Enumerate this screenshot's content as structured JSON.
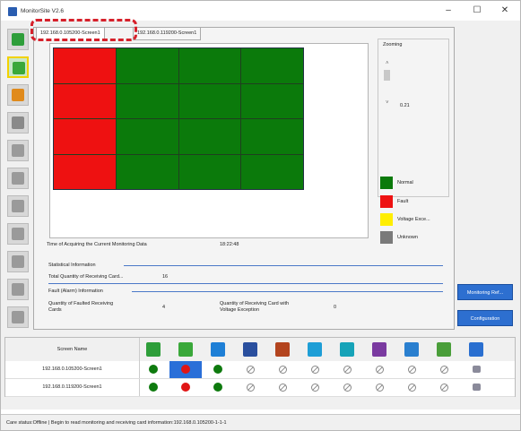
{
  "window": {
    "title": "MonitorSite V2.6",
    "minimize": "–",
    "maximize": "☐",
    "close": "✕"
  },
  "tabs": [
    {
      "label": "192.168.0.105200-Screen1",
      "selected": true
    },
    {
      "label": "192.168.0.119200-Screen1",
      "selected": false
    }
  ],
  "cabinet_grid": {
    "rows": 4,
    "cols": 4,
    "cells": [
      [
        "fault",
        "normal",
        "normal",
        "normal"
      ],
      [
        "fault",
        "normal",
        "normal",
        "normal"
      ],
      [
        "fault",
        "normal",
        "normal",
        "normal"
      ],
      [
        "fault",
        "normal",
        "normal",
        "normal"
      ]
    ]
  },
  "zoom": {
    "label": "Zooming",
    "value": "0.21"
  },
  "legend": [
    {
      "label": "Normal",
      "color": "#0b7a0b"
    },
    {
      "label": "Fault",
      "color": "#ee1111"
    },
    {
      "label": "Voltage Exce...",
      "color": "#ffee00"
    },
    {
      "label": "Unknown",
      "color": "#7a7a7a"
    }
  ],
  "info": {
    "time_label": "Time of Acquiring the Current Monitoring Data",
    "time_value": "18:22:48",
    "stat_header": "Statistical Information",
    "total_label": "Total Quantity of Receiving Card...",
    "total_value": "16",
    "fault_header": "Fault (Alarm) Information",
    "faulted_label_1": "Quantity of Faulted Receiving",
    "faulted_label_2": "Cards",
    "faulted_value": "4",
    "voltage_label_1": "Quantity of Receiving Card with",
    "voltage_label_2": "Voltage Exception",
    "voltage_value": "0"
  },
  "side_buttons": {
    "monitoring": "Monitoring Ref...",
    "configuration": "Configuration"
  },
  "left_toolbar": [
    {
      "icon": "monitor-green-icon",
      "color": "#2e9e3a"
    },
    {
      "icon": "receiving-card-icon",
      "color": "#3aa83a"
    },
    {
      "icon": "temperature-icon",
      "color": "#e08a1c"
    },
    {
      "icon": "disk-icon",
      "color": "#8a8a8a"
    },
    {
      "icon": "smoke-icon",
      "color": "#9a9a9a"
    },
    {
      "icon": "flame-icon",
      "color": "#9a9a9a"
    },
    {
      "icon": "fan-icon",
      "color": "#9a9a9a"
    },
    {
      "icon": "voltage-icon",
      "color": "#9a9a9a"
    },
    {
      "icon": "magnet-icon",
      "color": "#9a9a9a"
    },
    {
      "icon": "door-icon",
      "color": "#9a9a9a"
    },
    {
      "icon": "module-icon",
      "color": "#9a9a9a"
    }
  ],
  "table": {
    "header": "Screen Name",
    "header_icons": [
      {
        "name": "monitor-green-icon",
        "color": "#2e9e3a"
      },
      {
        "name": "receiving-card-icon",
        "color": "#3aa83a"
      },
      {
        "name": "temperature-icon",
        "color": "#1e7fd6"
      },
      {
        "name": "disk-icon",
        "color": "#2a4f9e"
      },
      {
        "name": "smoke-icon",
        "color": "#b3441e"
      },
      {
        "name": "fan-icon",
        "color": "#1e9ed6"
      },
      {
        "name": "voltage-icon",
        "color": "#16a3b8"
      },
      {
        "name": "magnet-icon",
        "color": "#7a3aa0"
      },
      {
        "name": "door-icon",
        "color": "#2a7fcf"
      },
      {
        "name": "module-icon",
        "color": "#4a9e3a"
      },
      {
        "name": "globe-icon",
        "color": "#2a6fd0"
      }
    ],
    "rows": [
      {
        "name": "192.168.0.105200-Screen1",
        "cells": [
          "green",
          "red-selected",
          "green",
          "na",
          "na",
          "na",
          "na",
          "na",
          "na",
          "na",
          "monitor"
        ]
      },
      {
        "name": "192.168.0.119200-Screen1",
        "cells": [
          "green",
          "red",
          "green",
          "na",
          "na",
          "na",
          "na",
          "na",
          "na",
          "na",
          "monitor"
        ]
      }
    ]
  },
  "status_bar": "Care status:Offline  |  Begin to read monitoring and receiving card information:192.168.0.105200-1-1-1"
}
